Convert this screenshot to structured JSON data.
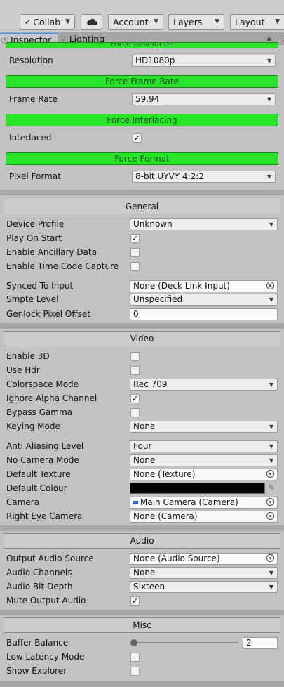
{
  "toolbar": {
    "collab_label": "Collab",
    "cloud_icon": "cloud-icon",
    "account_label": "Account",
    "layers_label": "Layers",
    "layout_label": "Layout"
  },
  "tabs": {
    "inspector": "Inspector",
    "lighting": "Lighting"
  },
  "top_group": {
    "header_clipped": "Force Resolution",
    "resolution_label": "Resolution",
    "resolution_value": "HD1080p",
    "force_frame_rate": "Force Frame Rate",
    "frame_rate_label": "Frame Rate",
    "frame_rate_value": "59.94",
    "force_interlacing": "Force Interlacing",
    "interlaced_label": "Interlaced",
    "force_format": "Force Format",
    "pixel_format_label": "Pixel Format",
    "pixel_format_value": "8-bit UYVY 4:2:2"
  },
  "general": {
    "title": "General",
    "device_profile_label": "Device Profile",
    "device_profile_value": "Unknown",
    "play_on_start_label": "Play On Start",
    "enable_ancillary_label": "Enable Ancillary Data",
    "enable_timecode_label": "Enable Time Code Capture",
    "synced_to_input_label": "Synced To Input",
    "synced_to_input_value": "None (Deck Link Input)",
    "smpte_level_label": "Smpte Level",
    "smpte_level_value": "Unspecified",
    "genlock_label": "Genlock Pixel Offset",
    "genlock_value": "0"
  },
  "video": {
    "title": "Video",
    "enable_3d_label": "Enable 3D",
    "use_hdr_label": "Use Hdr",
    "colorspace_label": "Colorspace Mode",
    "colorspace_value": "Rec 709",
    "ignore_alpha_label": "Ignore Alpha Channel",
    "bypass_gamma_label": "Bypass Gamma",
    "keying_label": "Keying Mode",
    "keying_value": "None",
    "anti_aliasing_label": "Anti Aliasing Level",
    "anti_aliasing_value": "Four",
    "no_camera_label": "No Camera Mode",
    "no_camera_value": "None",
    "default_texture_label": "Default Texture",
    "default_texture_value": "None (Texture)",
    "default_colour_label": "Default Colour",
    "default_colour_hex": "#000000",
    "camera_label": "Camera",
    "camera_value": "Main Camera (Camera)",
    "right_eye_label": "Right Eye Camera",
    "right_eye_value": "None (Camera)"
  },
  "audio": {
    "title": "Audio",
    "output_source_label": "Output Audio Source",
    "output_source_value": "None (Audio Source)",
    "channels_label": "Audio Channels",
    "channels_value": "None",
    "bit_depth_label": "Audio Bit Depth",
    "bit_depth_value": "Sixteen",
    "mute_label": "Mute Output Audio"
  },
  "misc": {
    "title": "Misc",
    "buffer_balance_label": "Buffer Balance",
    "buffer_balance_value": "2",
    "buffer_balance_fraction": 0.0,
    "low_latency_label": "Low Latency Mode",
    "show_explorer_label": "Show Explorer"
  },
  "checks": {
    "interlaced": true,
    "play_on_start": true,
    "enable_ancillary": false,
    "enable_timecode": false,
    "enable_3d": false,
    "use_hdr": false,
    "ignore_alpha": true,
    "bypass_gamma": false,
    "mute_output_audio": true,
    "low_latency": false,
    "show_explorer": false
  },
  "colors": {
    "force_bar_green": "#27e627",
    "tab_accent": "#4a90e2"
  }
}
